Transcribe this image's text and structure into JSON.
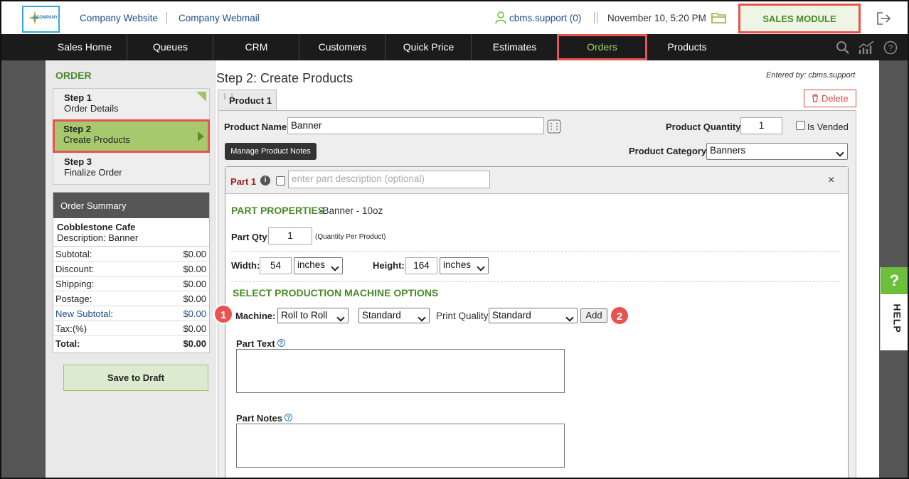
{
  "topbar": {
    "logo_text": "COMPANY",
    "company_website": "Company Website",
    "company_webmail": "Company Webmail",
    "user": "cbms.support (0)",
    "datetime": "November 10, 5:20 PM",
    "module": "SALES MODULE"
  },
  "nav": {
    "items": [
      "Sales Home",
      "Queues",
      "CRM",
      "Customers",
      "Quick Price",
      "Estimates",
      "Orders",
      "Products"
    ],
    "active": "Orders"
  },
  "sidebar": {
    "heading": "ORDER",
    "steps": [
      {
        "title": "Step 1",
        "label": "Order Details"
      },
      {
        "title": "Step 2",
        "label": "Create Products"
      },
      {
        "title": "Step 3",
        "label": "Finalize Order"
      }
    ],
    "summary": {
      "heading": "Order Summary",
      "customer": "Cobblestone Cafe",
      "description": "Description:  Banner",
      "rows": [
        {
          "label": "Subtotal:",
          "value": "$0.00"
        },
        {
          "label": "Discount:",
          "value": "$0.00"
        },
        {
          "label": "Shipping:",
          "value": "$0.00"
        },
        {
          "label": "Postage:",
          "value": "$0.00"
        },
        {
          "label": "New Subtotal:",
          "value": "$0.00"
        },
        {
          "label": "Tax:(%)",
          "value": "$0.00"
        },
        {
          "label": "Total:",
          "value": "$0.00"
        }
      ]
    },
    "save_draft": "Save to Draft"
  },
  "main": {
    "title": "Step 2: Create Products",
    "entered_by": "Entered by: cbms.support",
    "tab": "Product 1",
    "delete": "Delete",
    "product_name_label": "Product Name:",
    "product_name": "Banner",
    "product_qty_label": "Product Quantity:",
    "product_qty": "1",
    "is_vended": "Is Vended",
    "manage_notes": "Manage Product Notes",
    "category_label": "Product Category:",
    "category": "Banners",
    "part": {
      "title": "Part 1",
      "desc_placeholder": "enter part description (optional)",
      "properties_heading": "PART PROPERTIES",
      "properties_sub": "-Banner - 10oz",
      "qty_label": "Part Qty:",
      "qty": "1",
      "qty_note": "(Quantity Per Product)",
      "width_label": "Width:",
      "width": "54",
      "width_unit": "inches",
      "height_label": "Height:",
      "height": "164",
      "height_unit": "inches",
      "machine_heading": "SELECT PRODUCTION MACHINE OPTIONS",
      "machine_label": "Machine:",
      "machine": "Roll to Roll",
      "mode": "Standard",
      "print_quality_label": "Print Quality",
      "print_quality": "Standard",
      "add": "Add",
      "part_text_label": "Part Text",
      "part_notes_label": "Part Notes"
    }
  },
  "badges": [
    "1",
    "2"
  ],
  "help": {
    "icon": "?",
    "label": "HELP"
  }
}
